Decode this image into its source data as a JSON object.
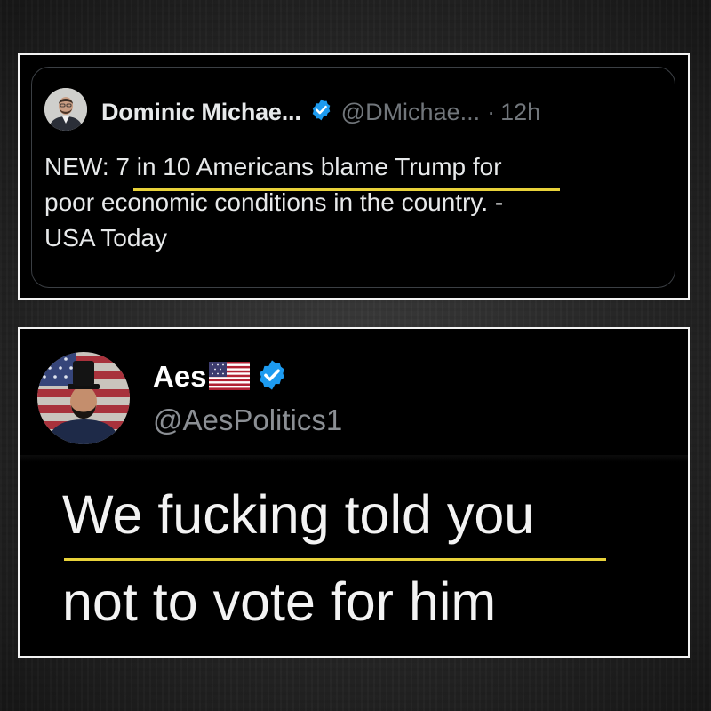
{
  "quoted_post": {
    "author_name": "Dominic Michae...",
    "verified": true,
    "handle": "@DMichae...",
    "separator": "·",
    "time": "12h",
    "text_lines": [
      "NEW: 7 in 10 Americans blame Trump for",
      "poor economic conditions in the country. -",
      "USA Today"
    ],
    "highlighted_phrase": "7 in 10 Americans blame Trump",
    "highlight_color": "#e8d23a"
  },
  "reply_post": {
    "author_name": "Aes",
    "flag_emoji": "us-flag",
    "verified": true,
    "handle": "@AesPolitics1",
    "text_lines": [
      "We fucking told you",
      "not to vote for him"
    ],
    "highlighted_phrase": "We fucking told you",
    "highlight_color": "#e8d23a"
  },
  "colors": {
    "verified_badge": "#1d9bf0",
    "primary_text": "#e7e9ea",
    "secondary_text": "#71767b",
    "panel_border": "#f2f2f2",
    "panel_background": "#000000"
  }
}
